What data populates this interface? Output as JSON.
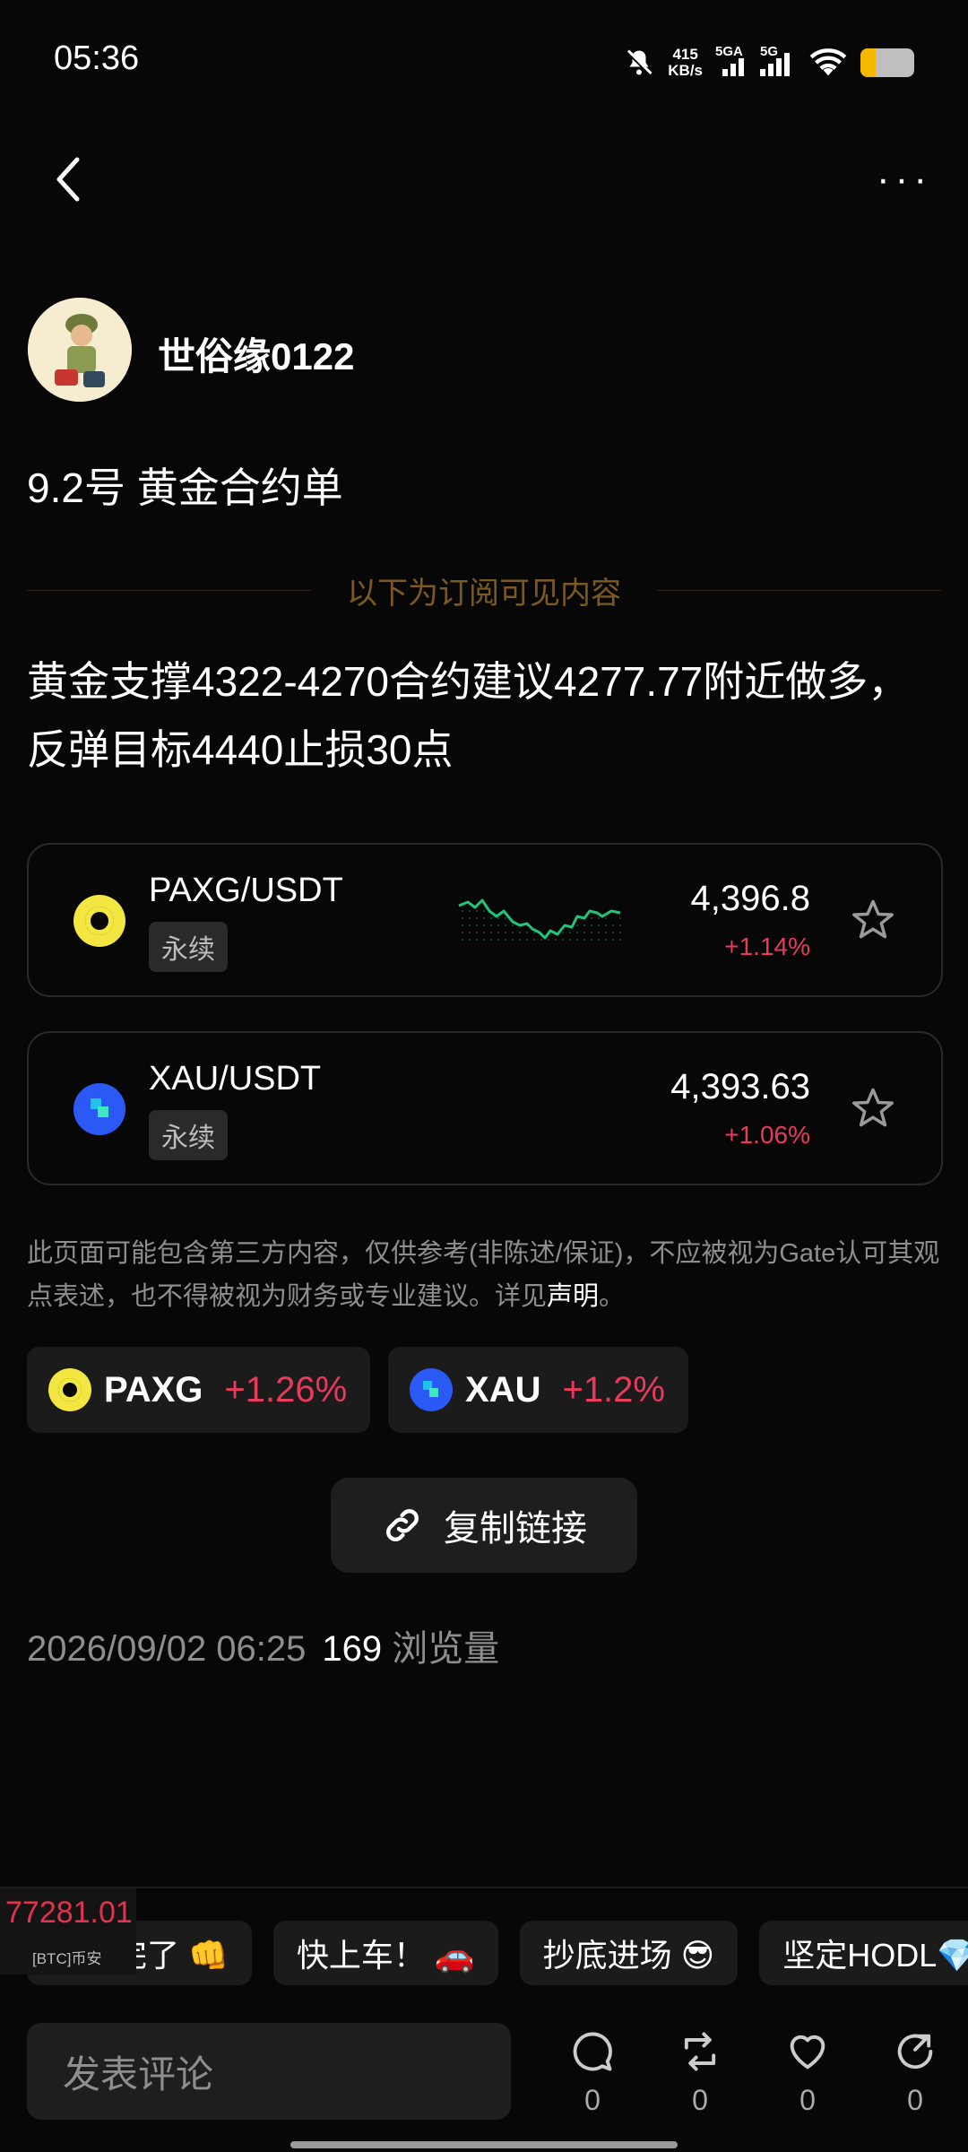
{
  "status_bar": {
    "time": "05:36",
    "net_speed_value": "415",
    "net_speed_unit": "KB/s",
    "sim1_label": "5GA",
    "sim2_label": "5G",
    "battery_level": 0.28
  },
  "post": {
    "author": "世俗缘0122",
    "title": "9.2号   黄金合约单",
    "subscriber_divider": "以下为订阅可见内容",
    "content": "黄金支撑4322-4270合约建议4277.77附近做多，反弹目标4440止损30点"
  },
  "markets": [
    {
      "pair": "PAXG/USDT",
      "tag": "永续",
      "price": "4,396.8",
      "change": "+1.14%",
      "icon": "paxg-coin-icon",
      "has_sparkline": true
    },
    {
      "pair": "XAU/USDT",
      "tag": "永续",
      "price": "4,393.63",
      "change": "+1.06%",
      "icon": "xau-coin-icon",
      "has_sparkline": false
    }
  ],
  "disclaimer": {
    "text": "此页面可能包含第三方内容，仅供参考(非陈述/保证)，不应被视为Gate认可其观点表述，也不得被视为财务或专业建议。详见",
    "link": "声明",
    "end": "。"
  },
  "chips": [
    {
      "symbol": "PAXG",
      "change": "+1.26%"
    },
    {
      "symbol": "XAU",
      "change": "+1.2%"
    }
  ],
  "copy_link_label": "复制链接",
  "meta": {
    "date": "2026/09/02 06:25",
    "views": "169",
    "views_label": "浏览量"
  },
  "quick_replies": [
    "冲就完了 👊",
    "快上车！ 🚗",
    "抄底进场 😎",
    "坚定HODL💎"
  ],
  "ticker": {
    "value": "77281.01",
    "label": "[BTC]币安"
  },
  "comment": {
    "placeholder": "发表评论",
    "comments_count": "0",
    "reposts_count": "0",
    "likes_count": "0",
    "shares_count": "0"
  },
  "colors": {
    "down_red": "#ea3a5b",
    "sparkline_green": "#22c37a",
    "background": "#070707"
  }
}
